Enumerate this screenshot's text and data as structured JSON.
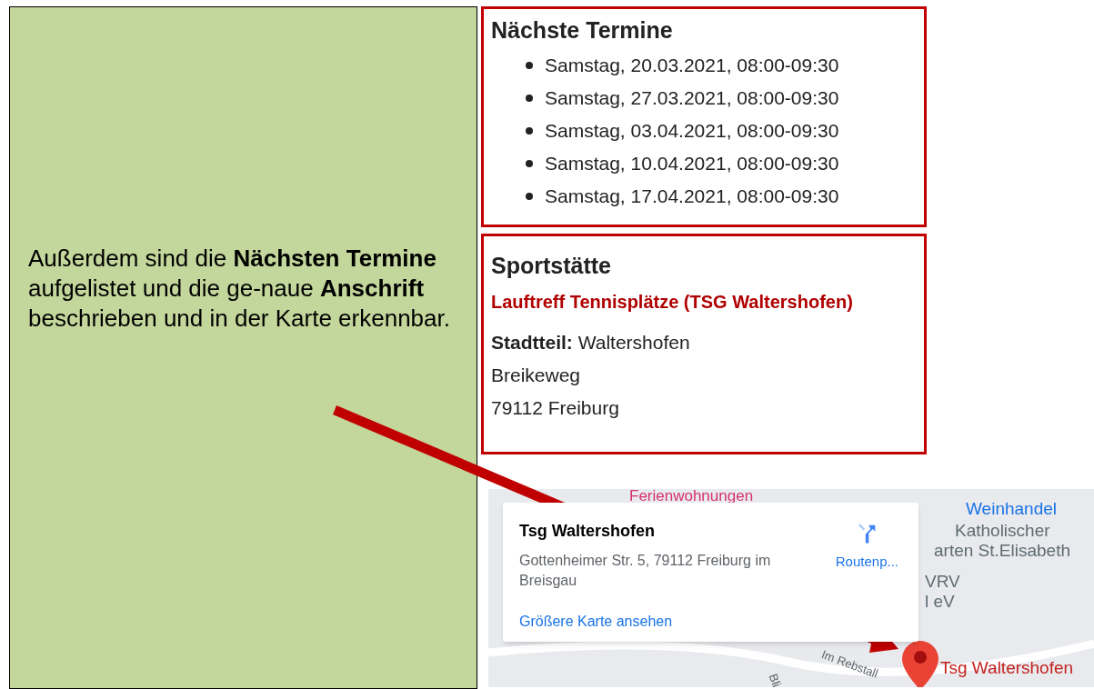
{
  "annotation": {
    "text": "Außerdem sind die **Nächsten Termine** aufgelistet und die ge-naue **Anschrift** beschrieben und in der Karte erkennbar."
  },
  "appointments": {
    "title": "Nächste Termine",
    "items": [
      "Samstag, 20.03.2021, 08:00-09:30",
      "Samstag, 27.03.2021, 08:00-09:30",
      "Samstag, 03.04.2021, 08:00-09:30",
      "Samstag, 10.04.2021, 08:00-09:30",
      "Samstag, 17.04.2021, 08:00-09:30"
    ]
  },
  "venue": {
    "title": "Sportstätte",
    "name": "Lauftreff Tennisplätze (TSG Waltershofen)",
    "district": "**Stadtteil:** Waltershofen",
    "street": "Breikeweg",
    "city": "79112 Freiburg"
  },
  "map": {
    "card": {
      "title": "Tsg Waltershofen",
      "address": "Gottenheimer Str. 5, 79112 Freiburg im Breisgau",
      "directions": "Routenp...",
      "larger_map": "Größere Karte ansehen"
    },
    "labels": [
      {
        "text": "Ferienwohnungen",
        "kind": "poi-pink"
      },
      {
        "text": "Weinhandel",
        "kind": "poi-blue"
      },
      {
        "text": "Katholischer",
        "kind": "poi-grey"
      },
      {
        "text": "arten St.Elisabeth",
        "kind": "poi-grey"
      },
      {
        "text": "VRV",
        "kind": "poi-grey"
      },
      {
        "text": "l eV",
        "kind": "poi-grey"
      },
      {
        "text": "Im Rebstall",
        "kind": "street"
      },
      {
        "text": "Bli",
        "kind": "street"
      }
    ],
    "marker": "Tsg Waltershofen"
  }
}
